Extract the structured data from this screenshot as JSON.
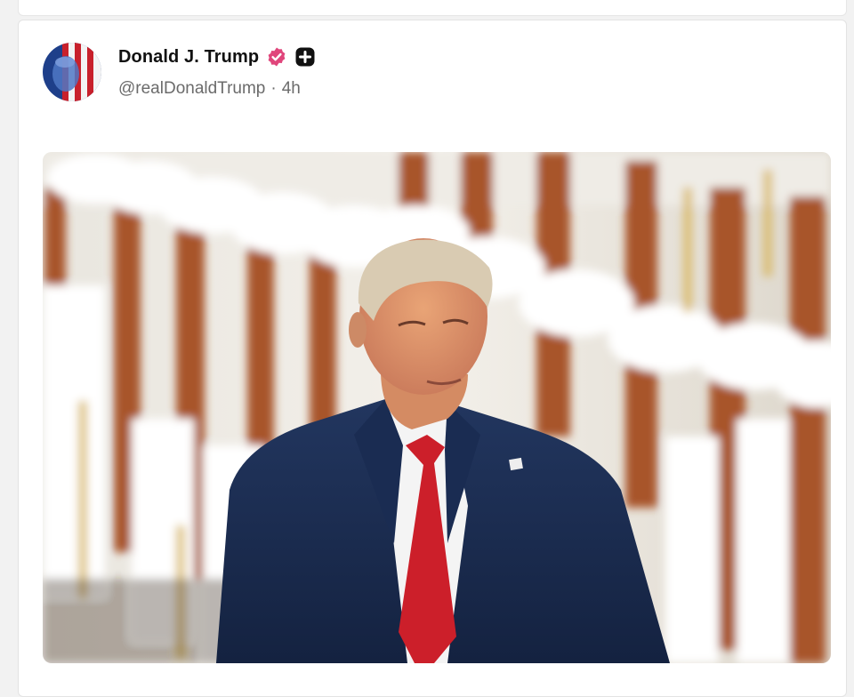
{
  "post": {
    "author_name": "Donald J. Trump",
    "handle": "@realDonaldTrump",
    "separator": "·",
    "time": "4h",
    "badges": {
      "verified_icon": "verified-badge-icon",
      "verified_color": "#e0457b",
      "plus_icon": "plus-badge-icon"
    },
    "media": {
      "type": "photo",
      "icon": "photo"
    }
  },
  "colors": {
    "background": "#f2f2f2",
    "card": "#ffffff",
    "name": "#111111",
    "meta": "#6b6b6b"
  }
}
